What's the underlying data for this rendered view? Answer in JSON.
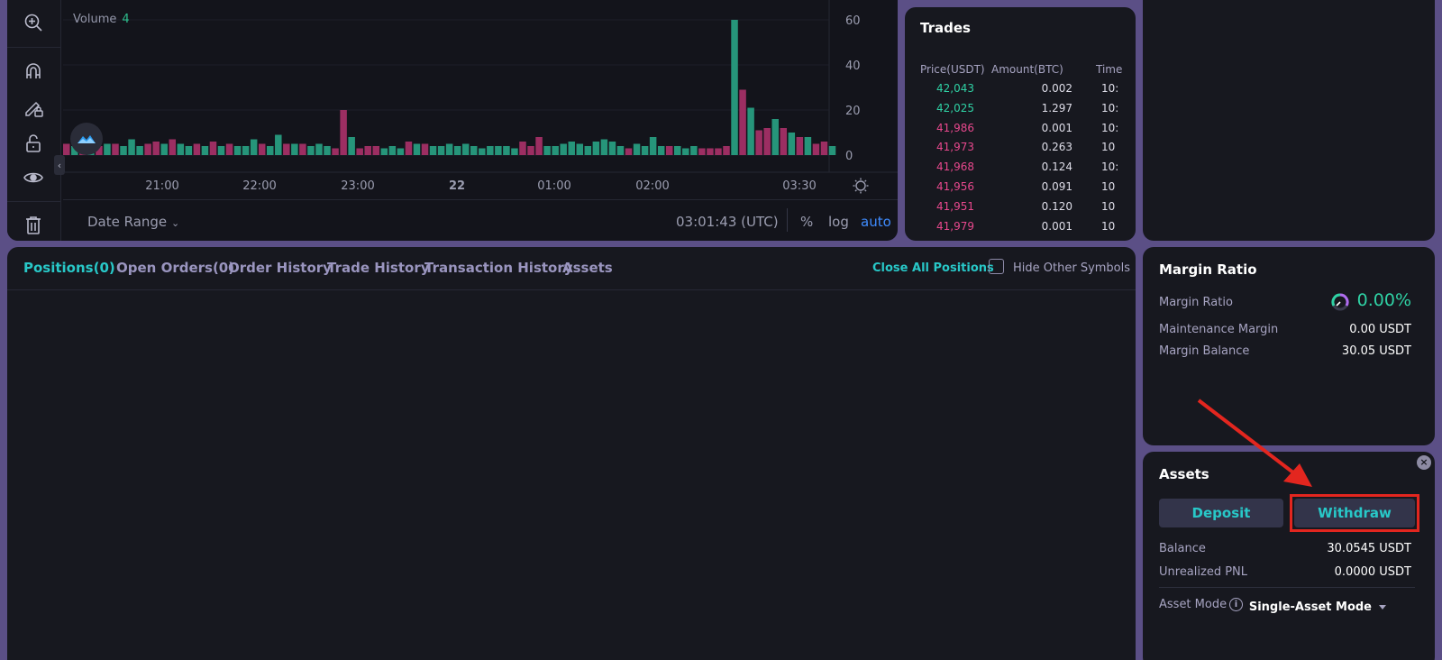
{
  "chart": {
    "volume_label": "Volume",
    "volume_value": "4",
    "y_ticks": [
      "60",
      "40",
      "20",
      "0"
    ],
    "x_ticks": [
      "21:00",
      "22:00",
      "23:00",
      "22",
      "01:00",
      "02:00",
      "03:30"
    ],
    "date_range_label": "Date Range",
    "clock": "03:01:43 (UTC)",
    "pct_label": "%",
    "log_label": "log",
    "auto_label": "auto",
    "colors": {
      "up": "#26957a",
      "down": "#9c2e62"
    },
    "bars": [
      [
        5,
        "d"
      ],
      [
        4,
        "u"
      ],
      [
        3,
        "d"
      ],
      [
        4,
        "u"
      ],
      [
        4,
        "d"
      ],
      [
        5,
        "u"
      ],
      [
        5,
        "d"
      ],
      [
        4,
        "u"
      ],
      [
        7,
        "u"
      ],
      [
        4,
        "u"
      ],
      [
        5,
        "d"
      ],
      [
        6,
        "d"
      ],
      [
        5,
        "u"
      ],
      [
        7,
        "d"
      ],
      [
        5,
        "u"
      ],
      [
        4,
        "u"
      ],
      [
        5,
        "d"
      ],
      [
        4,
        "u"
      ],
      [
        6,
        "d"
      ],
      [
        4,
        "u"
      ],
      [
        5,
        "d"
      ],
      [
        4,
        "u"
      ],
      [
        4,
        "u"
      ],
      [
        7,
        "u"
      ],
      [
        5,
        "d"
      ],
      [
        4,
        "u"
      ],
      [
        9,
        "u"
      ],
      [
        5,
        "d"
      ],
      [
        5,
        "u"
      ],
      [
        5,
        "d"
      ],
      [
        4,
        "u"
      ],
      [
        5,
        "u"
      ],
      [
        4,
        "u"
      ],
      [
        3,
        "d"
      ],
      [
        20,
        "d"
      ],
      [
        8,
        "u"
      ],
      [
        3,
        "d"
      ],
      [
        4,
        "d"
      ],
      [
        4,
        "d"
      ],
      [
        3,
        "u"
      ],
      [
        4,
        "u"
      ],
      [
        3,
        "u"
      ],
      [
        6,
        "d"
      ],
      [
        5,
        "u"
      ],
      [
        5,
        "d"
      ],
      [
        4,
        "u"
      ],
      [
        4,
        "u"
      ],
      [
        5,
        "u"
      ],
      [
        4,
        "u"
      ],
      [
        5,
        "u"
      ],
      [
        4,
        "u"
      ],
      [
        3,
        "u"
      ],
      [
        4,
        "u"
      ],
      [
        4,
        "u"
      ],
      [
        4,
        "u"
      ],
      [
        3,
        "u"
      ],
      [
        6,
        "d"
      ],
      [
        4,
        "d"
      ],
      [
        8,
        "d"
      ],
      [
        4,
        "u"
      ],
      [
        4,
        "u"
      ],
      [
        5,
        "u"
      ],
      [
        6,
        "u"
      ],
      [
        5,
        "u"
      ],
      [
        4,
        "u"
      ],
      [
        6,
        "u"
      ],
      [
        7,
        "u"
      ],
      [
        6,
        "u"
      ],
      [
        4,
        "u"
      ],
      [
        3,
        "d"
      ],
      [
        5,
        "u"
      ],
      [
        4,
        "u"
      ],
      [
        8,
        "u"
      ],
      [
        4,
        "u"
      ],
      [
        4,
        "d"
      ],
      [
        4,
        "u"
      ],
      [
        3,
        "u"
      ],
      [
        4,
        "u"
      ],
      [
        3,
        "d"
      ],
      [
        3,
        "d"
      ],
      [
        3,
        "d"
      ],
      [
        4,
        "d"
      ],
      [
        60,
        "u"
      ],
      [
        29,
        "d"
      ],
      [
        21,
        "u"
      ],
      [
        11,
        "d"
      ],
      [
        12,
        "d"
      ],
      [
        16,
        "u"
      ],
      [
        12,
        "d"
      ],
      [
        10,
        "u"
      ],
      [
        8,
        "d"
      ],
      [
        8,
        "u"
      ],
      [
        5,
        "d"
      ],
      [
        6,
        "d"
      ],
      [
        4,
        "u"
      ]
    ]
  },
  "trades": {
    "title": "Trades",
    "headers": [
      "Price(USDT)",
      "Amount(BTC)",
      "Time"
    ],
    "rows": [
      {
        "price": "42,043",
        "amount": "0.002",
        "time": "10:",
        "side": "buy"
      },
      {
        "price": "42,025",
        "amount": "1.297",
        "time": "10:",
        "side": "buy"
      },
      {
        "price": "41,986",
        "amount": "0.001",
        "time": "10:",
        "side": "sell"
      },
      {
        "price": "41,973",
        "amount": "0.263",
        "time": "10",
        "side": "sell"
      },
      {
        "price": "41,968",
        "amount": "0.124",
        "time": "10:",
        "side": "sell"
      },
      {
        "price": "41,956",
        "amount": "0.091",
        "time": "10",
        "side": "sell"
      },
      {
        "price": "41,951",
        "amount": "0.120",
        "time": "10",
        "side": "sell"
      },
      {
        "price": "41,979",
        "amount": "0.001",
        "time": "10",
        "side": "sell"
      }
    ],
    "colors": {
      "buy": "#2fd1a4",
      "sell": "#e8488d"
    }
  },
  "tabs": [
    "Positions(0)",
    "Open Orders(0)",
    "Order History",
    "Trade History",
    "Transaction History",
    "Assets"
  ],
  "positions": {
    "close_all_label": "Close All Positions",
    "hide_other_label": "Hide Other Symbols"
  },
  "margin": {
    "title": "Margin Ratio",
    "ratio_label": "Margin Ratio",
    "ratio_value": "0.00%",
    "maintenance_label": "Maintenance Margin",
    "maintenance_value": "0.00 USDT",
    "balance_label": "Margin Balance",
    "balance_value": "30.05 USDT"
  },
  "assets": {
    "title": "Assets",
    "deposit_label": "Deposit",
    "withdraw_label": "Withdraw",
    "balance_label": "Balance",
    "balance_value": "30.0545 USDT",
    "pnl_label": "Unrealized PNL",
    "pnl_value": "0.0000 USDT",
    "mode_label": "Asset Mode",
    "mode_value": "Single-Asset Mode"
  }
}
